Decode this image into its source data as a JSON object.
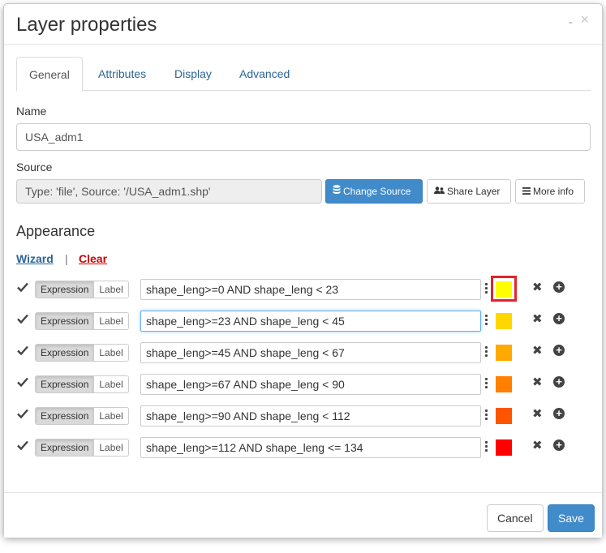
{
  "dialog": {
    "title": "Layer properties",
    "minimize_glyph": "-",
    "close_glyph": "×"
  },
  "tabs": [
    {
      "label": "General",
      "active": true
    },
    {
      "label": "Attributes",
      "active": false
    },
    {
      "label": "Display",
      "active": false
    },
    {
      "label": "Advanced",
      "active": false
    }
  ],
  "name": {
    "label": "Name",
    "value": "USA_adm1"
  },
  "source": {
    "label": "Source",
    "value": "Type: 'file', Source: '/USA_adm1.shp'",
    "change_source_label": "Change Source",
    "share_layer_label": "Share Layer",
    "more_info_label": "More info"
  },
  "appearance": {
    "heading": "Appearance",
    "wizard_label": "Wizard",
    "separator": "|",
    "clear_label": "Clear",
    "rules": [
      {
        "mode_on": "Expression",
        "mode_off": "Label",
        "expression": "shape_leng>=0 AND shape_leng < 23",
        "color": "#ffff00",
        "selected": true
      },
      {
        "mode_on": "Expression",
        "mode_off": "Label",
        "expression": "shape_leng>=23 AND shape_leng < 45",
        "color": "#ffd700",
        "selected": false
      },
      {
        "mode_on": "Expression",
        "mode_off": "Label",
        "expression": "shape_leng>=45 AND shape_leng < 67",
        "color": "#ffaa00",
        "selected": false
      },
      {
        "mode_on": "Expression",
        "mode_off": "Label",
        "expression": "shape_leng>=67 AND shape_leng < 90",
        "color": "#ff8000",
        "selected": false
      },
      {
        "mode_on": "Expression",
        "mode_off": "Label",
        "expression": "shape_leng>=90 AND shape_leng < 112",
        "color": "#ff5500",
        "selected": false
      },
      {
        "mode_on": "Expression",
        "mode_off": "Label",
        "expression": "shape_leng>=112 AND shape_leng <= 134",
        "color": "#ff0000",
        "selected": false
      }
    ]
  },
  "footer": {
    "cancel_label": "Cancel",
    "save_label": "Save"
  },
  "colors": {
    "primary": "#428bca",
    "link": "#2a6496",
    "danger": "#cc0000",
    "selection_border": "#e0252b"
  },
  "icons": {
    "change_source": "database-icon",
    "share_layer": "users-icon",
    "more_info": "list-icon",
    "rule_check": "check-icon",
    "rule_menu": "kebab-menu-icon",
    "rule_delete": "close-icon",
    "rule_add": "plus-circle-icon"
  }
}
